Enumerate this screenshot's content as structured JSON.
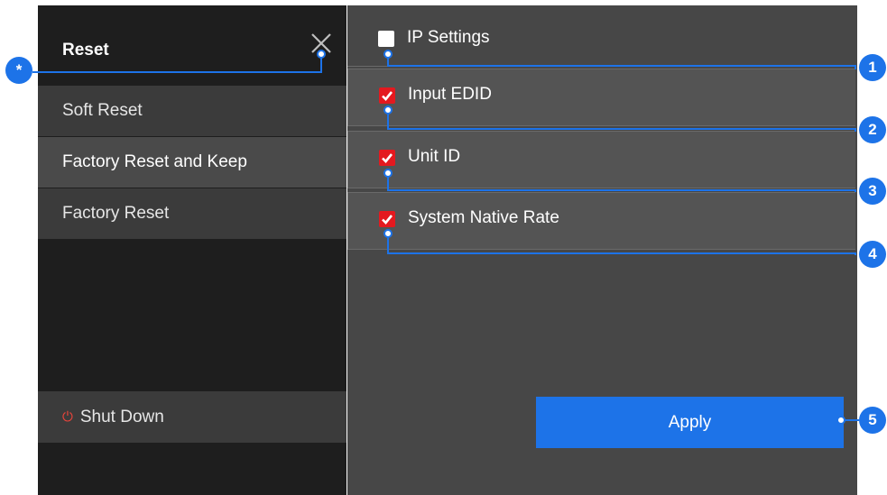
{
  "sidebar": {
    "title": "Reset",
    "items": [
      {
        "label": "Soft Reset"
      },
      {
        "label": "Factory Reset and Keep"
      },
      {
        "label": "Factory Reset"
      }
    ],
    "shutdown_label": "Shut Down"
  },
  "options": [
    {
      "label": "IP Settings",
      "checked": false
    },
    {
      "label": "Input EDID",
      "checked": true
    },
    {
      "label": "Unit ID",
      "checked": true
    },
    {
      "label": "System Native Rate",
      "checked": true
    }
  ],
  "apply_label": "Apply",
  "callouts": [
    "*",
    "1",
    "2",
    "3",
    "4",
    "5"
  ],
  "colors": {
    "accent": "#1d73e8",
    "checkbox_checked": "#e4191f",
    "power_icon": "#e8443b"
  }
}
